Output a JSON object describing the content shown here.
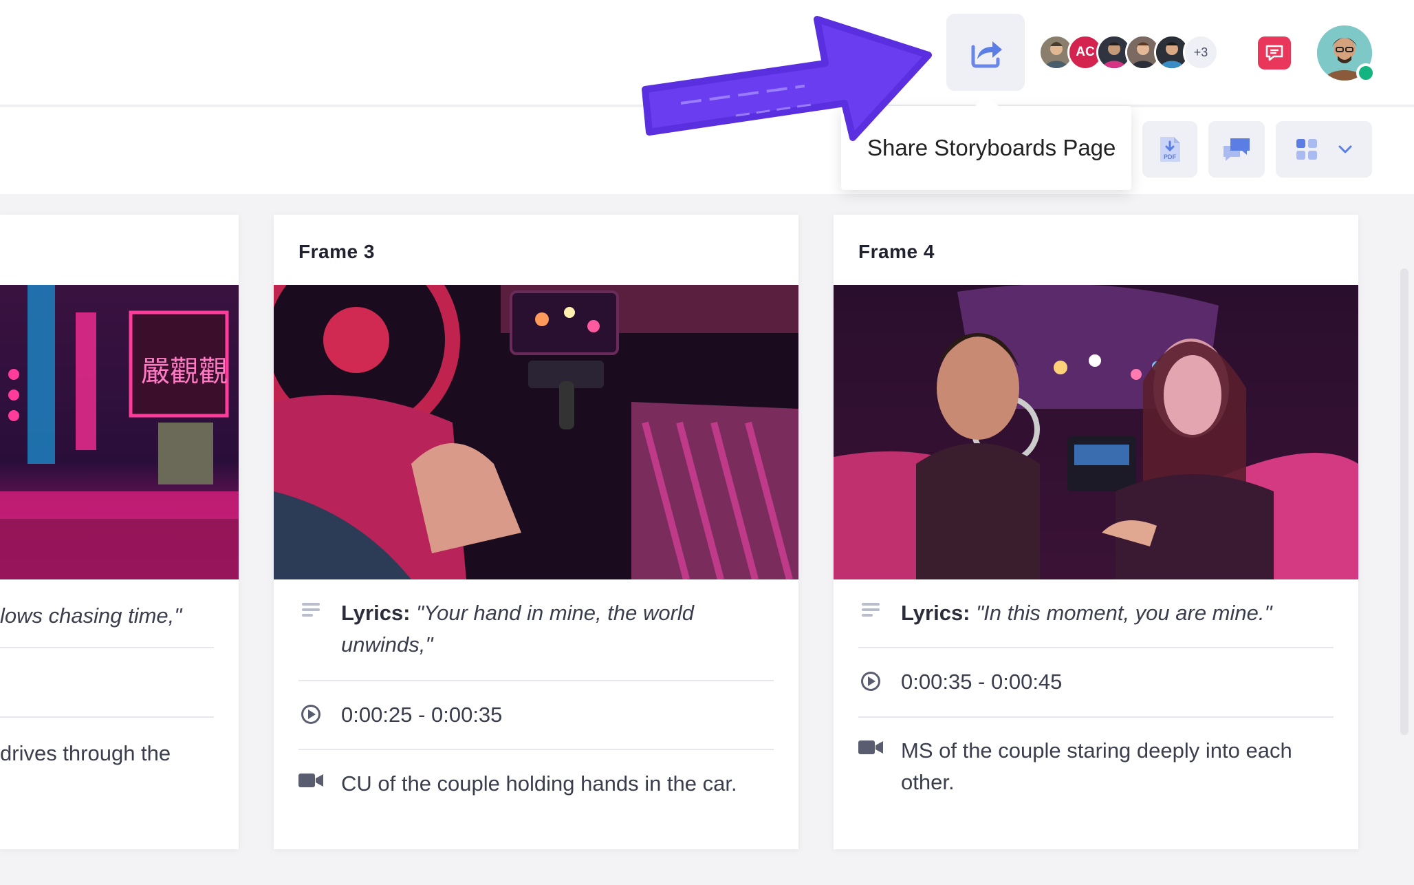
{
  "header": {
    "share_tooltip": "Share Storyboards Page",
    "avatars": [
      {
        "initials": "",
        "color": "#8a7f6d"
      },
      {
        "initials": "AC",
        "color": "#d4234e"
      },
      {
        "initials": "",
        "color": "#3f4a5c"
      },
      {
        "initials": "",
        "color": "#6d5a52"
      },
      {
        "initials": "",
        "color": "#4d6f8c"
      }
    ],
    "more_count": "+3"
  },
  "frames": [
    {
      "title": "",
      "lyrics_label": "",
      "lyrics": "lows chasing time,\"",
      "timecode": "",
      "shot": "drives through the"
    },
    {
      "title": "Frame  3",
      "lyrics_label": "Lyrics:",
      "lyrics": "\"Your hand in mine, the world unwinds,\"",
      "timecode": "0:00:25 - 0:00:35",
      "shot": "CU of the couple holding hands in the car."
    },
    {
      "title": "Frame  4",
      "lyrics_label": "Lyrics:",
      "lyrics": "\"In this moment, you are mine.\"",
      "timecode": "0:00:35 - 0:00:45",
      "shot": "MS of the couple staring deeply into each other."
    }
  ],
  "icons": {
    "share": "share-arrow-icon",
    "pdf": "pdf-download-icon",
    "comments": "comments-icon",
    "layout": "grid-layout-icon",
    "chevron": "chevron-down-icon",
    "chat": "chat-icon",
    "lyrics": "text-lines-icon",
    "timecode": "play-circle-icon",
    "shot": "video-camera-icon"
  },
  "colors": {
    "accent": "#5b7ee5",
    "annotation_arrow": "#6a3df0",
    "chat_button": "#e8375a",
    "online": "#13b47f"
  }
}
